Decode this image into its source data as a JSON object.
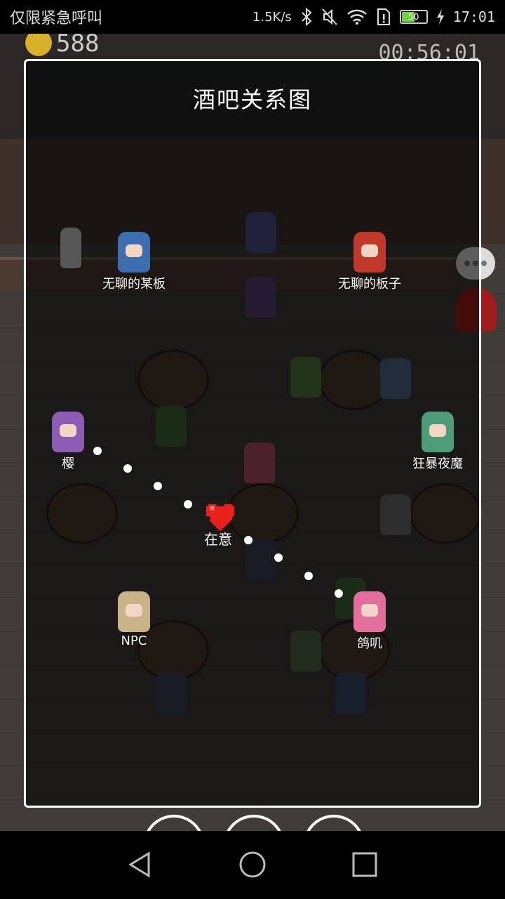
{
  "status_bar": {
    "carrier_text": "仅限紧急呼叫",
    "net_speed": "1.5K/s",
    "battery_level": "50",
    "time": "17:01",
    "icons": [
      "bluetooth-icon",
      "mute-icon",
      "wifi-icon",
      "sim-alert-icon",
      "battery-icon",
      "charging-icon"
    ]
  },
  "hud": {
    "gold": "588",
    "timer": "00:56:01"
  },
  "dialog": {
    "title": "酒吧关系图",
    "center_label": "在意",
    "characters": [
      {
        "id": "bored-board-1",
        "name": "无聊的某板",
        "color": "#3d6fb0"
      },
      {
        "id": "bored-board-2",
        "name": "无聊的板子",
        "color": "#c0392b"
      },
      {
        "id": "sakura",
        "name": "樱",
        "color": "#8e5bb5"
      },
      {
        "id": "berserk",
        "name": "狂暴夜魔",
        "color": "#4d9c7a"
      },
      {
        "id": "npc",
        "name": "NPC",
        "color": "#c9b48a"
      },
      {
        "id": "pigeon",
        "name": "鸽叽",
        "color": "#e36d9c"
      }
    ]
  },
  "colors": {
    "heart": "#e8201e",
    "overlay_border": "#ffffff"
  }
}
